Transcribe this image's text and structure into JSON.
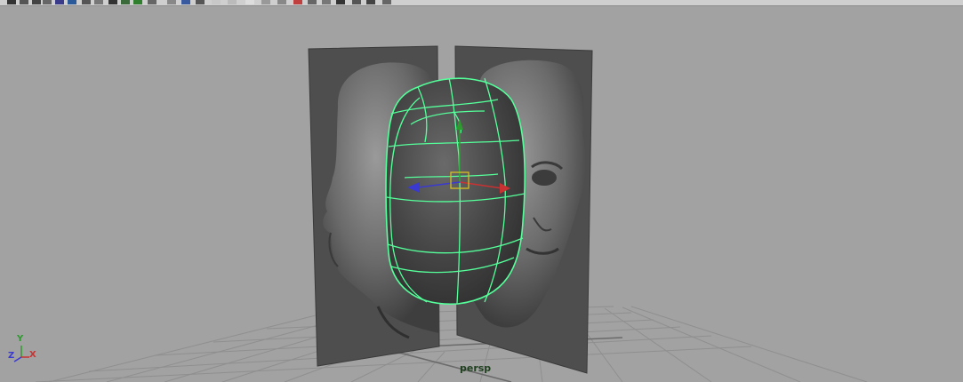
{
  "app": {
    "toolbar": {
      "icons": [
        "select-tool-icon",
        "lasso-tool-icon",
        "paint-select-icon",
        "move-tool-icon",
        "rotate-tool-icon",
        "scale-tool-icon",
        "soft-mod-icon",
        "show-manipulator-icon",
        "last-tool-icon",
        "render-frame-icon",
        "render-view-icon",
        "ipr-render-icon",
        "render-settings-icon",
        "hypershade-icon",
        "snap-grid-icon",
        "snap-curve-icon",
        "snap-point-icon",
        "snap-plane-icon",
        "make-live-icon",
        "history-icon",
        "construction-history-icon",
        "input-ops-icon",
        "output-ops-icon",
        "sculpt-icon",
        "channel-box-icon",
        "attribute-editor-icon",
        "tool-settings-icon"
      ]
    }
  },
  "viewport": {
    "camera_name": "persp",
    "axis_labels": {
      "x": "X",
      "y": "Y",
      "z": "Z"
    },
    "colors": {
      "background": "#a2a2a2",
      "grid": "#8f8f8f",
      "grid_axis": "#6a6a6a",
      "image_plane": "#4e4e4e",
      "mesh_wireframe": "#55ff9a",
      "head_mesh": "#4a4a4a",
      "manipulator_x": "#c83232",
      "manipulator_y": "#2f9a2f",
      "manipulator_z": "#3a3ad0",
      "pivot_box": "#d8c020"
    }
  }
}
